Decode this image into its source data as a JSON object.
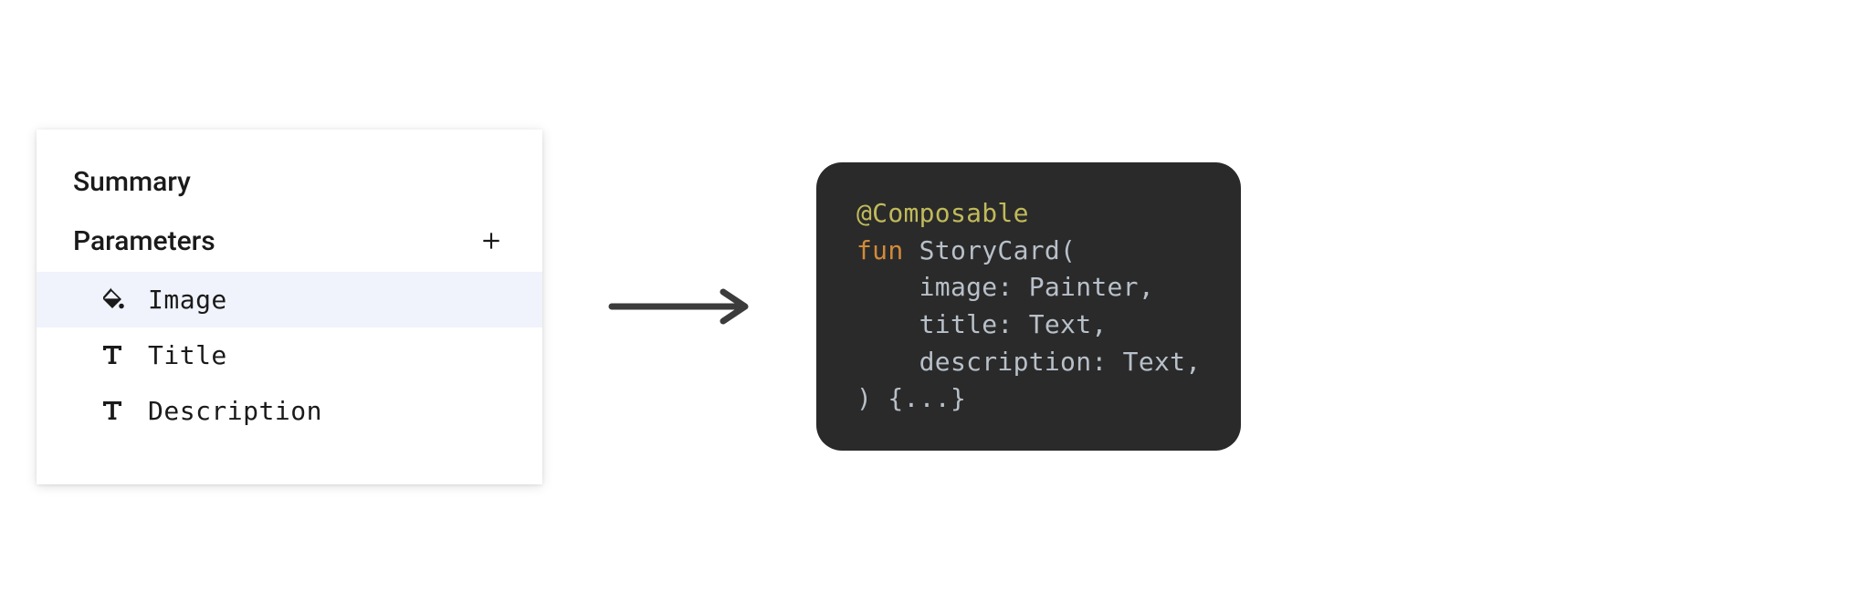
{
  "panel": {
    "summary_label": "Summary",
    "parameters_label": "Parameters",
    "params": [
      {
        "name": "Image",
        "icon": "paint-bucket",
        "selected": true
      },
      {
        "name": "Title",
        "icon": "text",
        "selected": false
      },
      {
        "name": "Description",
        "icon": "text",
        "selected": false
      }
    ]
  },
  "code": {
    "annotation": "@Composable",
    "keyword_fun": "fun",
    "func_name": " StoryCard(",
    "param1": "    image: Painter,",
    "param2": "    title: Text,",
    "param3": "    description: Text,",
    "close": ") {...}"
  }
}
